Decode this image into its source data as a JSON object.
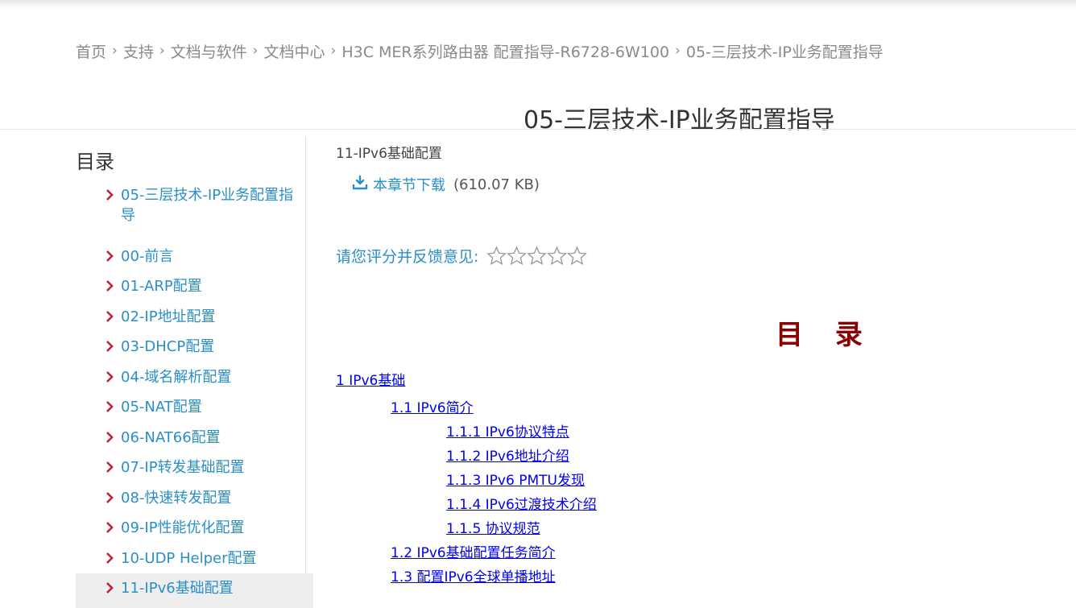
{
  "breadcrumb": {
    "items": [
      "首页",
      "支持",
      "文档与软件",
      "文档中心",
      "H3C MER系列路由器 配置指导-R6728-6W100",
      "05-三层技术-IP业务配置指导"
    ],
    "separator": "›"
  },
  "doc_title": "05-三层技术-IP业务配置指导",
  "sidebar": {
    "heading": "目录",
    "items": [
      {
        "label": "05-三层技术-IP业务配置指导"
      },
      {
        "label": "00-前言"
      },
      {
        "label": "01-ARP配置"
      },
      {
        "label": "02-IP地址配置"
      },
      {
        "label": "03-DHCP配置"
      },
      {
        "label": "04-域名解析配置"
      },
      {
        "label": "05-NAT配置"
      },
      {
        "label": "06-NAT66配置"
      },
      {
        "label": "07-IP转发基础配置"
      },
      {
        "label": "08-快速转发配置"
      },
      {
        "label": "09-IP性能优化配置"
      },
      {
        "label": "10-UDP Helper配置"
      },
      {
        "label": "11-IPv6基础配置"
      }
    ],
    "active_index": 12
  },
  "main": {
    "section_label": "11-IPv6基础配置",
    "download_label": "本章节下载",
    "download_size": "(610.07 KB)",
    "rating_label": "请您评分并反馈意见:",
    "rating_stars": 5,
    "rating_value": 0,
    "toc_title": "目 录",
    "toc_links": [
      "1 IPv6基础",
      "1.1 IPv6简介",
      "1.1.1 IPv6协议特点",
      "1.1.2 IPv6地址介绍",
      "1.1.3 IPv6 PMTU发现",
      "1.1.4 IPv6过渡技术介绍",
      "1.1.5 协议规范",
      "1.2 IPv6基础配置任务简介",
      "1.3 配置IPv6全球单播地址"
    ]
  },
  "colors": {
    "link_blue": "#2a8fc8",
    "chevron_red": "#c0213a",
    "toc_title_red": "#8b0000",
    "hyperlink": "#0000ee"
  }
}
